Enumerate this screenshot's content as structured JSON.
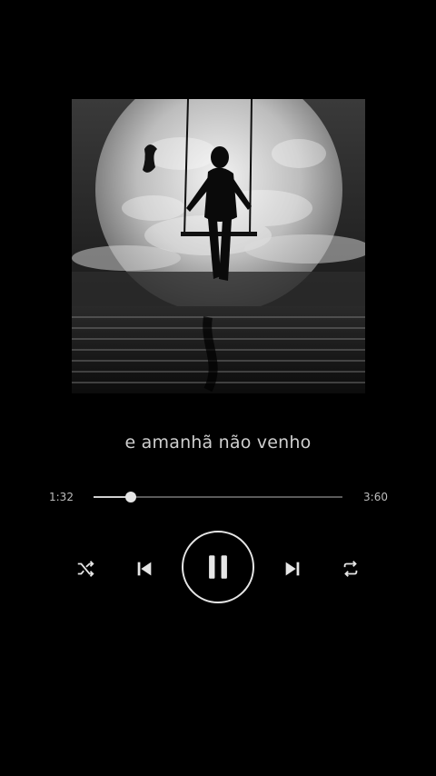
{
  "album_art": {
    "icon": "moon-swing-artwork"
  },
  "lyric": {
    "line": "e amanhã não venho"
  },
  "progress": {
    "elapsed": "1:32",
    "total": "3:60",
    "fraction": 0.15
  },
  "controls": {
    "shuffle_icon": "shuffle-icon",
    "previous_icon": "skip-previous-icon",
    "play_pause_icon": "pause-icon",
    "next_icon": "skip-next-icon",
    "repeat_icon": "repeat-icon"
  }
}
